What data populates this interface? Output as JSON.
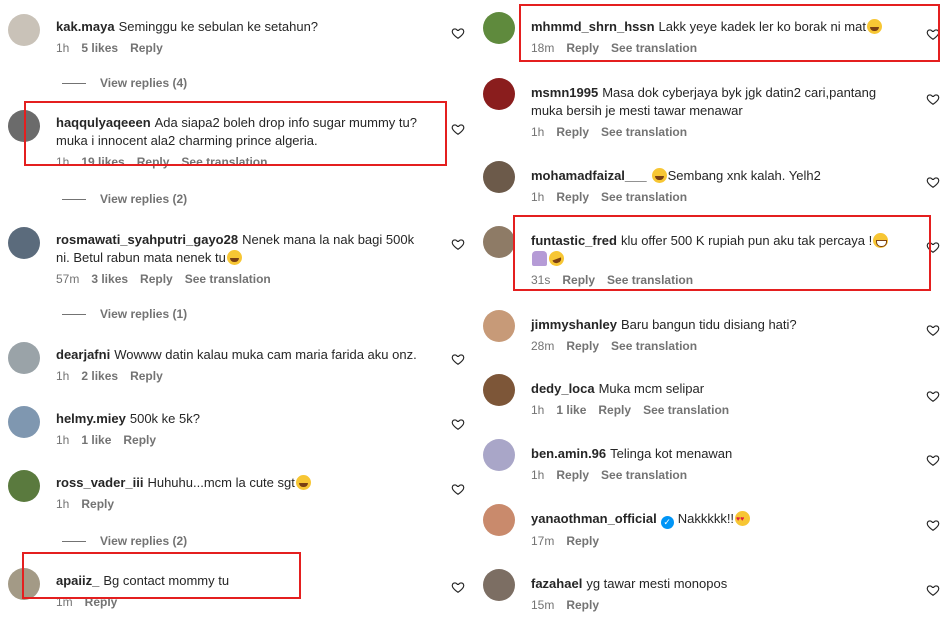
{
  "left": [
    {
      "user": "kak.maya",
      "text": "Seminggu ke sebulan ke setahun?",
      "time": "1h",
      "likes": "5 likes",
      "reply": "Reply",
      "see_translation": "",
      "avatar_color": "#c9c2b8",
      "view_replies": "View replies (4)"
    },
    {
      "user": "haqqulyaqeeen",
      "text": "Ada siapa2 boleh drop info sugar mummy tu? muka i innocent ala2 charming prince algeria.",
      "time": "1h",
      "likes": "19 likes",
      "reply": "Reply",
      "see_translation": "See translation",
      "avatar_color": "#6b6b6b",
      "view_replies": "View replies (2)"
    },
    {
      "user": "rosmawati_syahputri_gayo28",
      "text": "Nenek mana la nak bagi 500k ni. Betul rabun mata nenek tu",
      "emoji": "laugh",
      "time": "57m",
      "likes": "3 likes",
      "reply": "Reply",
      "see_translation": "See translation",
      "avatar_color": "#5b6b7c",
      "view_replies": "View replies (1)"
    },
    {
      "user": "dearjafni",
      "text": "Wowww datin kalau muka cam maria farida aku onz.",
      "time": "1h",
      "likes": "2 likes",
      "reply": "Reply",
      "see_translation": "",
      "avatar_color": "#9aa3a8"
    },
    {
      "user": "helmy.miey",
      "text": "500k ke 5k?",
      "time": "1h",
      "likes": "1 like",
      "reply": "Reply",
      "see_translation": "",
      "avatar_color": "#7f97b0"
    },
    {
      "user": "ross_vader_iii",
      "text": "Huhuhu...mcm la cute sgt",
      "emoji": "laugh",
      "time": "1h",
      "likes": "",
      "reply": "Reply",
      "see_translation": "",
      "avatar_color": "#5a7a3e",
      "view_replies": "View replies (2)"
    },
    {
      "user": "apaiiz_",
      "text": "Bg contact mommy tu",
      "time": "1m",
      "likes": "",
      "reply": "Reply",
      "see_translation": "",
      "avatar_color": "#a39a86"
    }
  ],
  "right": [
    {
      "user": "mhmmd_shrn_hssn",
      "text": "Lakk yeye kadek ler ko borak ni mat",
      "emoji": "laugh",
      "time": "18m",
      "likes": "",
      "reply": "Reply",
      "see_translation": "See translation",
      "avatar_color": "#5f8a3d"
    },
    {
      "user": "msmn1995",
      "text": "Masa dok cyberjaya byk jgk datin2 cari,pantang muka bersih je mesti tawar menawar",
      "time": "1h",
      "likes": "",
      "reply": "Reply",
      "see_translation": "See translation",
      "avatar_color": "#8a1d1d"
    },
    {
      "user": "mohamadfaizal___",
      "text": "Sembang xnk kalah. Yelh2",
      "emoji_before": "laugh",
      "time": "1h",
      "likes": "",
      "reply": "Reply",
      "see_translation": "See translation",
      "avatar_color": "#6c5a4a"
    },
    {
      "user": "funtastic_fred",
      "text": "klu offer 500 K rupiah pun aku tak percaya !",
      "emoji": "grin",
      "line2_emojis": [
        "person",
        "rofl"
      ],
      "time": "31s",
      "likes": "",
      "reply": "Reply",
      "see_translation": "See translation",
      "avatar_color": "#8e7b66"
    },
    {
      "user": "jimmyshanley",
      "text": "Baru bangun tidu disiang hati?",
      "time": "28m",
      "likes": "",
      "reply": "Reply",
      "see_translation": "See translation",
      "avatar_color": "#c79a78"
    },
    {
      "user": "dedy_loca",
      "text": "Muka mcm selipar",
      "time": "1h",
      "likes": "1 like",
      "reply": "Reply",
      "see_translation": "See translation",
      "avatar_color": "#7d5638"
    },
    {
      "user": "ben.amin.96",
      "text": "Telinga kot menawan",
      "time": "1h",
      "likes": "",
      "reply": "Reply",
      "see_translation": "See translation",
      "avatar_color": "#a9a6c8"
    },
    {
      "user": "yanaothman_official",
      "verified": true,
      "text": "Nakkkkk!!",
      "emoji": "hearteyes",
      "time": "17m",
      "likes": "",
      "reply": "Reply",
      "see_translation": "",
      "avatar_color": "#c98a6c"
    },
    {
      "user": "fazahael",
      "text": "yg tawar mesti monopos",
      "time": "15m",
      "likes": "",
      "reply": "Reply",
      "see_translation": "",
      "avatar_color": "#7c6e63"
    }
  ],
  "colors": {
    "highlight": "#e41f1f",
    "text": "#262626",
    "meta": "#737373",
    "verified": "#0095f6"
  }
}
